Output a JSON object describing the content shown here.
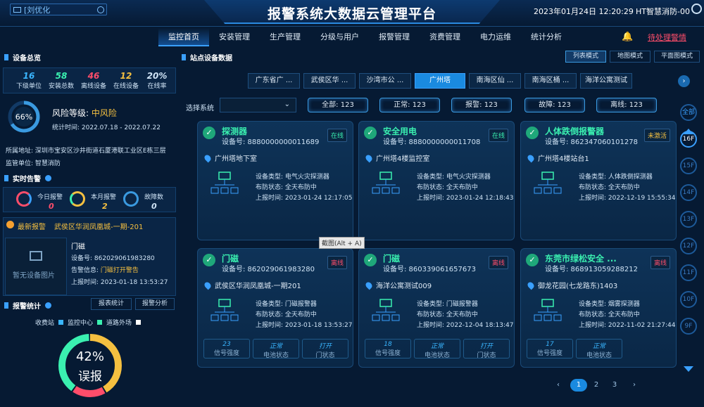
{
  "header": {
    "title": "报警系统大数据云管理平台",
    "search_text": "[刘优化",
    "datetime": "2023年01月24日 12:20:29",
    "company": "HT智慧消防-00"
  },
  "nav": {
    "items": [
      "监控首页",
      "安装管理",
      "生产管理",
      "分级与用户",
      "报警管理",
      "资费管理",
      "电力运维",
      "统计分析"
    ],
    "pending": "待处理警情"
  },
  "overview": {
    "title": "设备总览",
    "stats": [
      {
        "value": "16",
        "label": "下级单位",
        "color": "#3ab6ff"
      },
      {
        "value": "58",
        "label": "安装总数",
        "color": "#3af0b0"
      },
      {
        "value": "46",
        "label": "离线设备",
        "color": "#ff4d6a"
      },
      {
        "value": "12",
        "label": "在线设备",
        "color": "#f5c040"
      },
      {
        "value": "20%",
        "label": "在线率",
        "color": "#cfe3f5"
      }
    ],
    "risk_percent": "66%",
    "risk_label": "风险等级:",
    "risk_level": "中风险",
    "stat_time": "统计时间: 2022.07.18 - 2022.07.22",
    "address": "所属地址:   深圳市宝安区沙井街道石厦港联工业区E栋三层",
    "unit": "监管单位: 智慧消防"
  },
  "realtime": {
    "title": "实时告警",
    "items": [
      {
        "label": "今日报警",
        "value": "0",
        "color": "#ff4d6a"
      },
      {
        "label": "本月报警",
        "value": "2",
        "color": "#f5c040"
      },
      {
        "label": "故障数",
        "value": "0",
        "color": "#cfe3f5"
      }
    ],
    "latest_label": "最新报警",
    "latest_place": "武侯区华润凤凰城-一期-201",
    "no_image": "暂无设备图片",
    "device": "门磁",
    "device_no": "设备号: 862029061983280",
    "alarm_info_label": "告警信息:",
    "alarm_info": "门磁打开警告",
    "report_time": "上报时间: 2023-01-18 13:53:27"
  },
  "alarm_stats": {
    "title": "报警统计",
    "btn_report": "报表统计",
    "btn_analysis": "报警分析",
    "legend": [
      "收费站",
      "监控中心",
      "道路外场"
    ],
    "donut_percent": "42%",
    "donut_label": "误报",
    "segments": [
      {
        "value": 0.42,
        "color": "#f5c040"
      },
      {
        "value": 0.18,
        "color": "#ff4d6a"
      },
      {
        "value": 0.4,
        "color": "#3af0b0"
      }
    ]
  },
  "station": {
    "title": "站点设备数据",
    "modes": [
      "列表模式",
      "地图模式",
      "平面图模式"
    ],
    "tabs": [
      "广东省广 ...",
      "武侯区华 ...",
      "沙湾市公 ...",
      "广州塔",
      "南海区仙 ...",
      "南海区桶 ...",
      "海洋公寓测试"
    ],
    "select_label": "选择系统",
    "filters": [
      "全部:  123",
      "正常:  123",
      "报警:  123",
      "故障:  123",
      "离线:  123"
    ],
    "tooltip": "截图(Alt + A)"
  },
  "cards": [
    {
      "name": "探测器",
      "no": "设备号: 8880000000011689",
      "status": "在线",
      "status_color": "#3af0b0",
      "loc": "广州塔地下室",
      "type": "设备类型: 电气火灾探测器",
      "arm": "布防状态: 全天布防中",
      "time": "上报时间: 2023-01-24 12:17:05",
      "minis": []
    },
    {
      "name": "安全用电",
      "no": "设备号: 8880000000011708",
      "status": "在线",
      "status_color": "#3af0b0",
      "loc": "广州塔4楼监控室",
      "type": "设备类型: 电气火灾探测器",
      "arm": "布防状态: 全天布防中",
      "time": "上报时间: 2023-01-24 12:18:43",
      "minis": []
    },
    {
      "name": "人体跌倒报警器",
      "no": "设备号: 862347060101278",
      "status": "未激活",
      "status_color": "#f5c040",
      "loc": "广州塔4楼站台1",
      "type": "设备类型: 人体跌倒探测器",
      "arm": "布防状态: 全天布防中",
      "time": "上报时间: 2022-12-19 15:55:34",
      "minis": []
    },
    {
      "name": "门磁",
      "no": "设备号: 862029061983280",
      "status": "离线",
      "status_color": "#ff4d6a",
      "loc": "武侯区华润凤凰城-一期201",
      "type": "设备类型: 门磁报警器",
      "arm": "布防状态: 全天布防中",
      "time": "上报时间: 2023-01-18 13:53:27",
      "minis": [
        {
          "a": "23",
          "b": "信号强度"
        },
        {
          "a": "正常",
          "b": "电池状态"
        },
        {
          "a": "打开",
          "b": "门状态"
        }
      ]
    },
    {
      "name": "门磁",
      "no": "设备号: 860339061657673",
      "status": "离线",
      "status_color": "#ff4d6a",
      "loc": "海洋公寓测试009",
      "type": "设备类型: 门磁报警器",
      "arm": "布防状态: 全天布防中",
      "time": "上报时间: 2022-12-04 18:13:47",
      "minis": [
        {
          "a": "18",
          "b": "信号强度"
        },
        {
          "a": "正常",
          "b": "电池状态"
        },
        {
          "a": "打开",
          "b": "门状态"
        }
      ]
    },
    {
      "name": "东莞市绿松安全 ...",
      "no": "设备号: 868913059288212",
      "status": "离线",
      "status_color": "#ff4d6a",
      "loc": "御龙花园(七龙路东)1403",
      "type": "设备类型: 烟雾探测器",
      "arm": "布防状态: 全天布防中",
      "time": "上报时间: 2022-11-02 21:27:44",
      "minis": [
        {
          "a": "17",
          "b": "信号强度"
        },
        {
          "a": "正常",
          "b": "电池状态"
        }
      ]
    }
  ],
  "floors": [
    "全部",
    "16F",
    "15F",
    "14F",
    "13F",
    "12F",
    "11F",
    "10F",
    "9F"
  ],
  "pagination": [
    "1",
    "2",
    "3"
  ]
}
